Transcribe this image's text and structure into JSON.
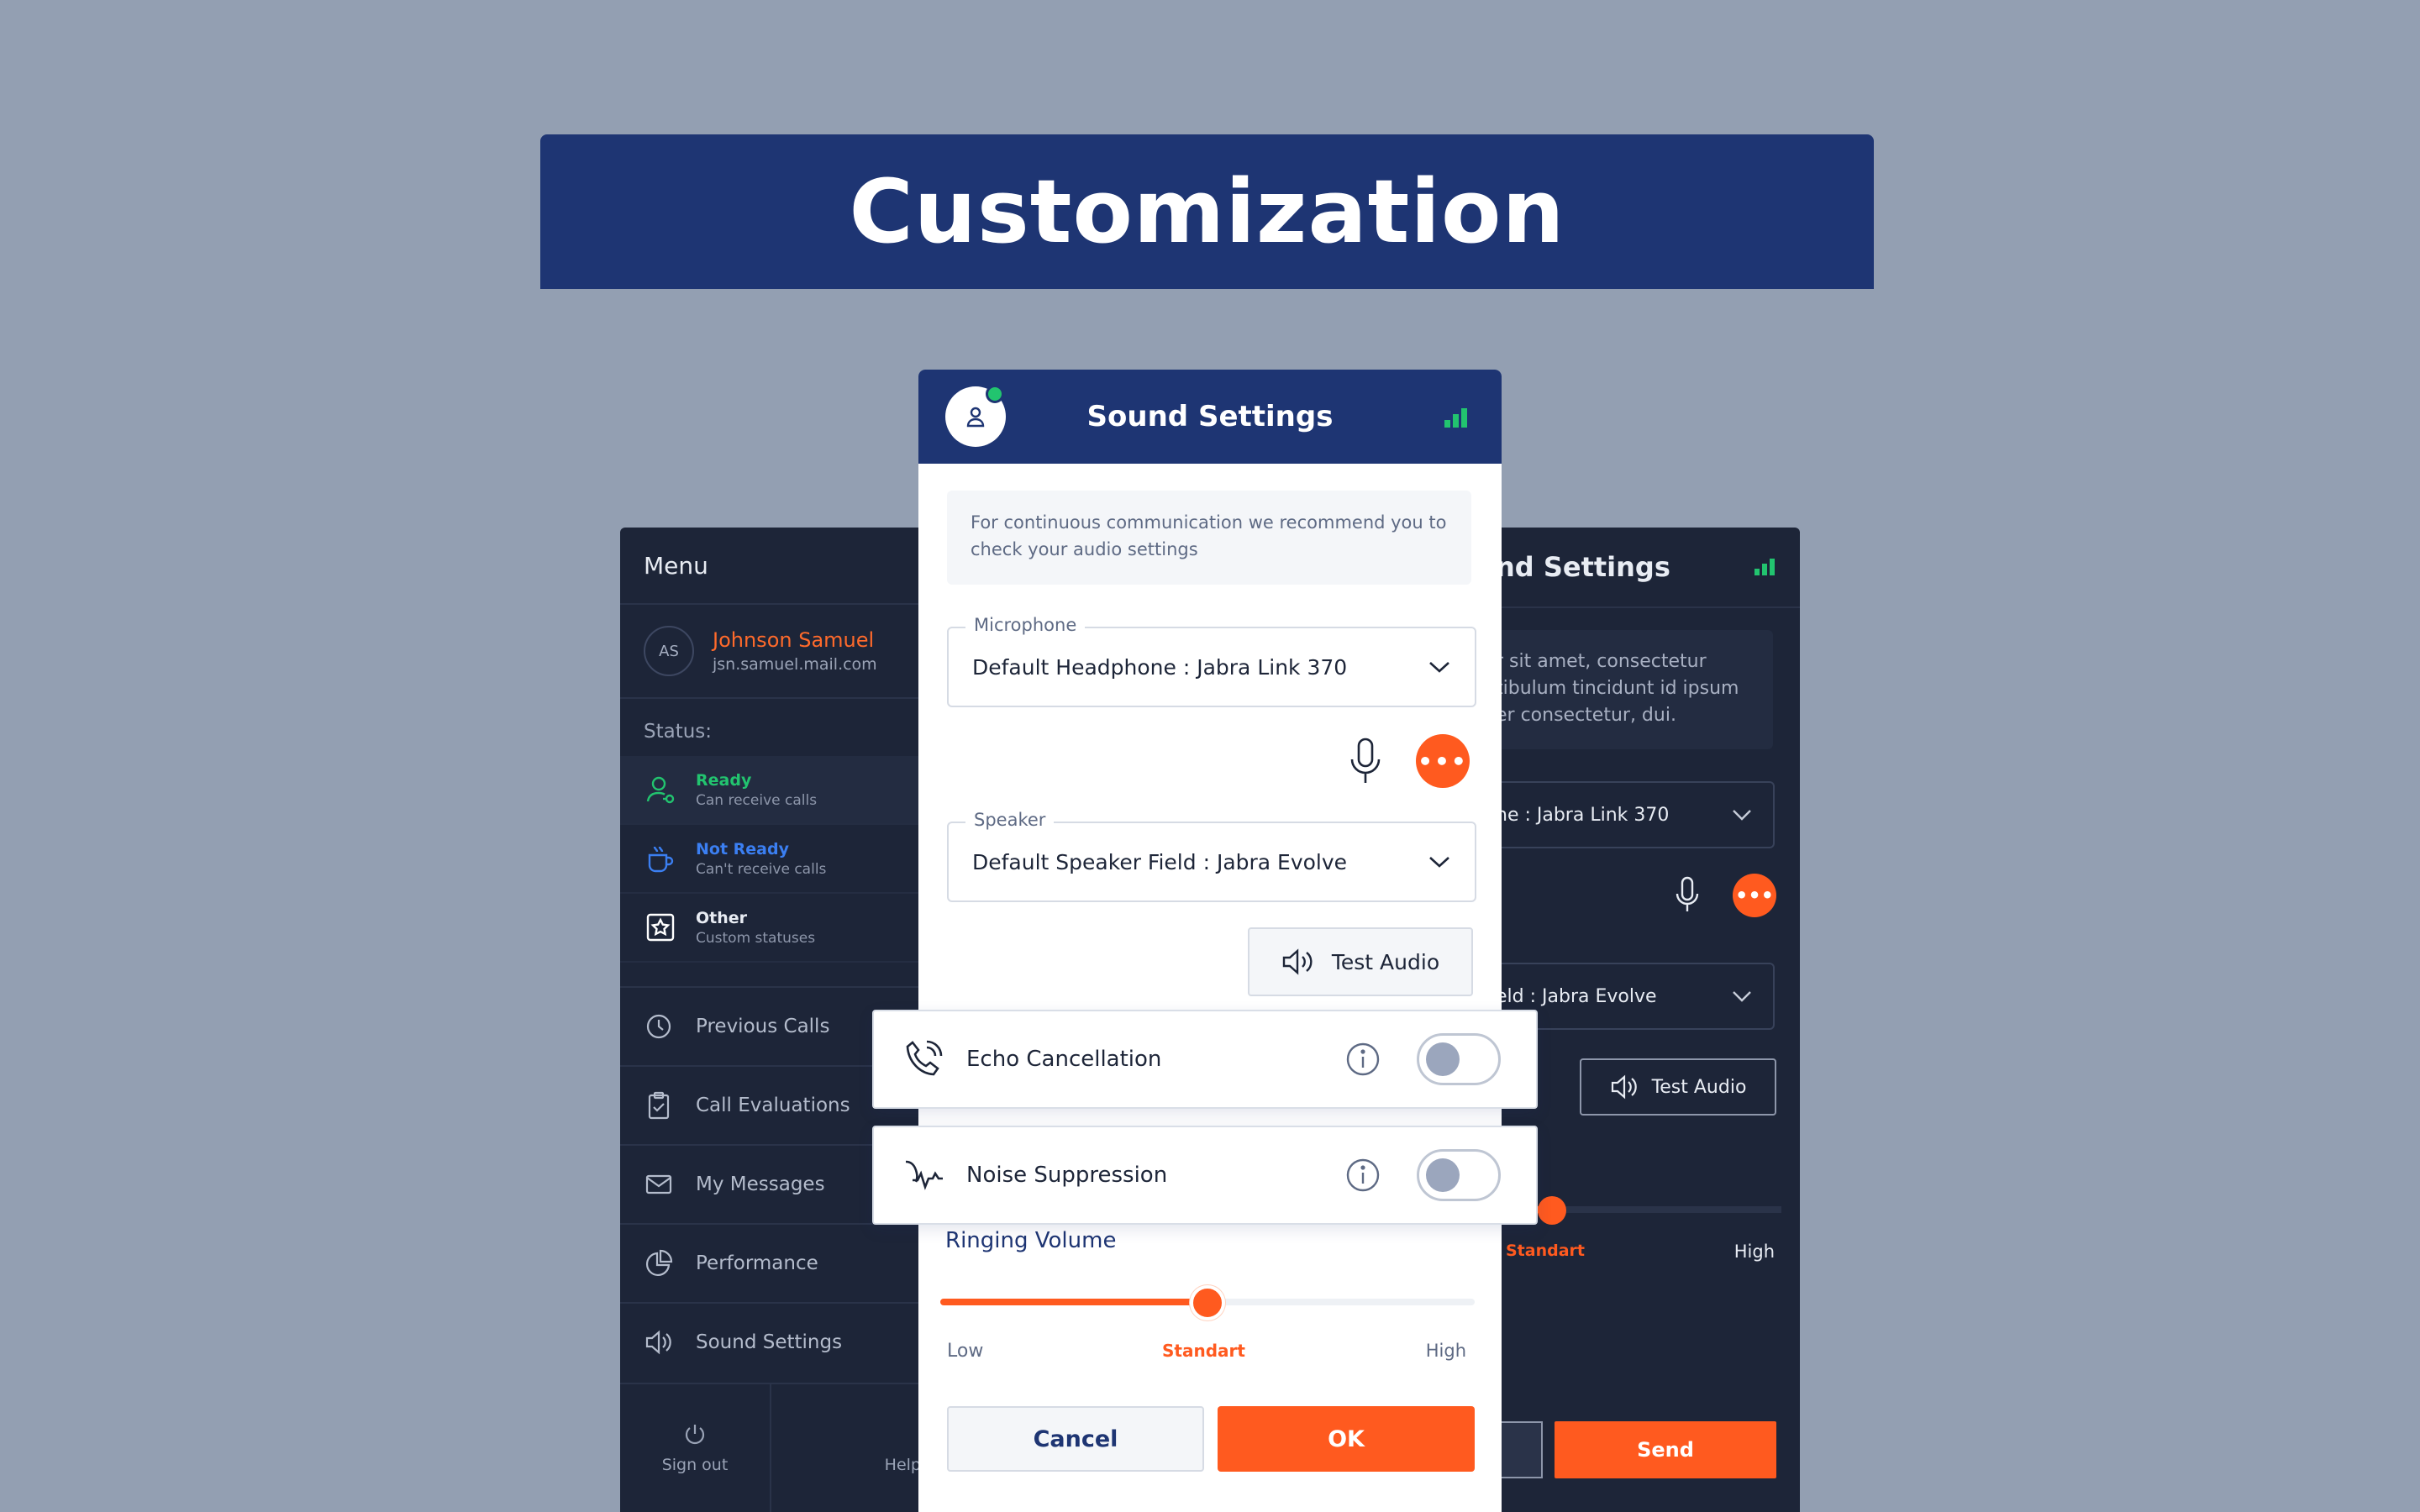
{
  "banner": {
    "title": "Customization"
  },
  "menu": {
    "title": "Menu",
    "user": {
      "initials": "AS",
      "name": "Johnson Samuel",
      "email": "jsn.samuel.mail.com"
    },
    "status_label": "Status:",
    "statuses": [
      {
        "title": "Ready",
        "subtitle": "Can receive calls",
        "color": "#22c46f"
      },
      {
        "title": "Not Ready",
        "subtitle": "Can't receive calls",
        "color": "#3b7ff2"
      },
      {
        "title": "Other",
        "subtitle": "Custom statuses",
        "color": "#ffffff"
      }
    ],
    "nav": [
      {
        "label": "Previous Calls",
        "icon": "history-icon"
      },
      {
        "label": "Call Evaluations",
        "icon": "clipboard-icon"
      },
      {
        "label": "My Messages",
        "icon": "mail-icon"
      },
      {
        "label": "Performance",
        "icon": "pie-chart-icon"
      },
      {
        "label": "Sound Settings",
        "icon": "speaker-icon"
      }
    ],
    "bottom": {
      "signout": "Sign out",
      "help": "Help"
    }
  },
  "modal": {
    "title": "Sound Settings",
    "info": "For continuous communication we recommend you to check your audio settings",
    "microphone": {
      "legend": "Microphone",
      "value": "Default Headphone : Jabra Link 370"
    },
    "speaker": {
      "legend": "Speaker",
      "value": "Default Speaker Field : Jabra Evolve"
    },
    "test_audio": "Test Audio",
    "ringing": {
      "label": "Ringing Volume",
      "low": "Low",
      "mid": "Standart",
      "high": "High",
      "value": 0.5
    },
    "cancel": "Cancel",
    "ok": "OK"
  },
  "toggles": {
    "echo": {
      "label": "Echo Cancellation",
      "on": false
    },
    "noise": {
      "label": "Noise Suppression",
      "on": false
    }
  },
  "dark_panel": {
    "title": "nd Settings",
    "info_lines": [
      "r sit amet, consectetur",
      "tibulum tincidunt id ipsum",
      "er consectetur, dui."
    ],
    "microphone_value": "ne : Jabra Link 370",
    "speaker_value": "eld : Jabra Evolve",
    "test_audio": "Test Audio",
    "mid": "Standart",
    "high": "High",
    "send": "Send"
  },
  "colors": {
    "accent": "#ff5a1f",
    "navy": "#1e3573",
    "dark": "#1d2538",
    "success": "#22c46f"
  }
}
